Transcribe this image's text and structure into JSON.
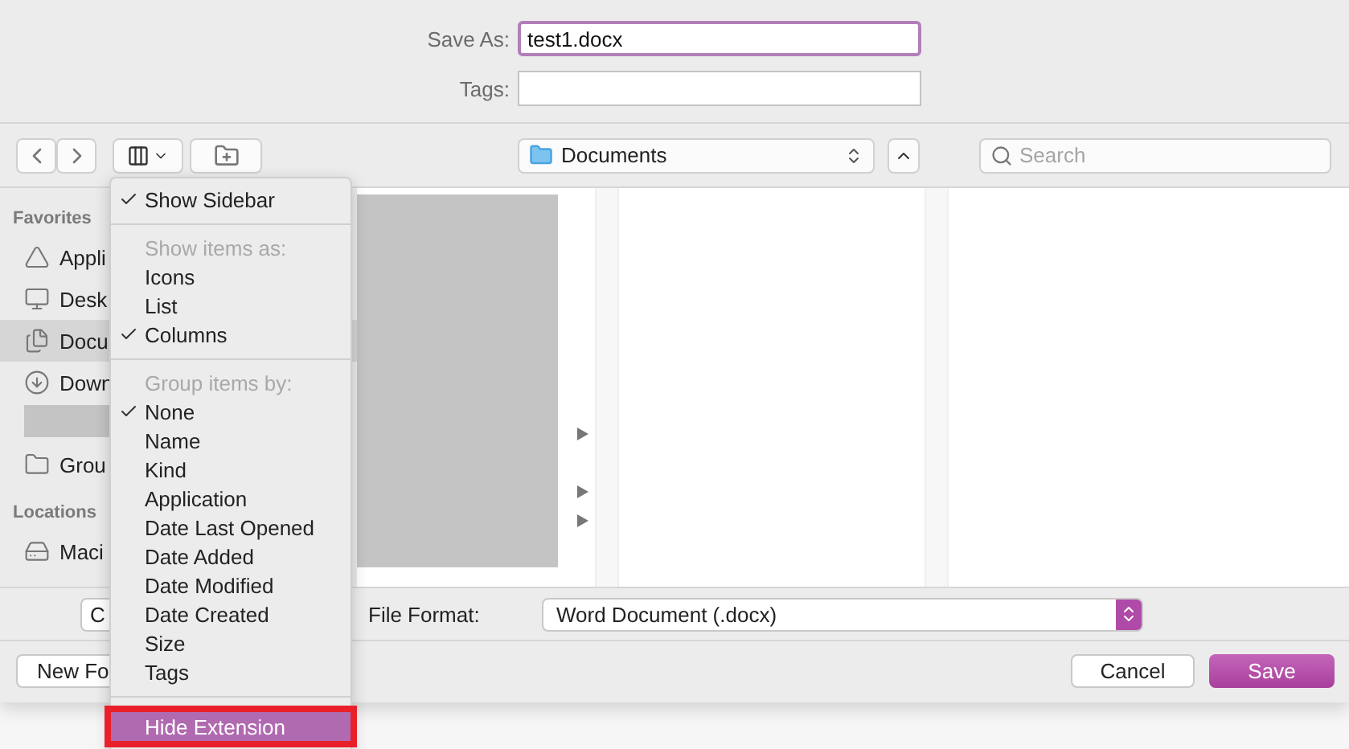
{
  "save_as": {
    "label": "Save As:",
    "value": "test1.docx"
  },
  "tags": {
    "label": "Tags:"
  },
  "location": {
    "label": "Documents"
  },
  "search": {
    "placeholder": "Search"
  },
  "sidebar": {
    "sections": [
      {
        "title": "Favorites",
        "items": [
          {
            "kind": "apps",
            "label": "Appli",
            "selected": false
          },
          {
            "kind": "desktop",
            "label": "Desk",
            "selected": false
          },
          {
            "kind": "documents",
            "label": "Docu",
            "selected": true
          },
          {
            "kind": "downloads",
            "label": "Down",
            "selected": false
          },
          {
            "kind": "redacted",
            "selected": false
          },
          {
            "kind": "folder",
            "label": "Grou",
            "selected": false
          }
        ]
      },
      {
        "title": "Locations",
        "items": [
          {
            "kind": "disk",
            "label": "Maci",
            "selected": false
          }
        ]
      }
    ]
  },
  "options": {
    "button": "C",
    "file_format_label": "File Format:",
    "file_format": "Word Document (.docx)"
  },
  "buttons": {
    "new_folder": "New Fo",
    "cancel": "Cancel",
    "save": "Save"
  },
  "menu": [
    {
      "kind": "item",
      "label": "Show Sidebar",
      "checked": true,
      "selected": false
    },
    {
      "kind": "separator"
    },
    {
      "kind": "header",
      "label": "Show items as:"
    },
    {
      "kind": "item",
      "label": "Icons",
      "checked": false,
      "selected": false
    },
    {
      "kind": "item",
      "label": "List",
      "checked": false,
      "selected": false
    },
    {
      "kind": "item",
      "label": "Columns",
      "checked": true,
      "selected": false
    },
    {
      "kind": "separator"
    },
    {
      "kind": "header",
      "label": "Group items by:"
    },
    {
      "kind": "item",
      "label": "None",
      "checked": true,
      "selected": false
    },
    {
      "kind": "item",
      "label": "Name",
      "checked": false,
      "selected": false
    },
    {
      "kind": "item",
      "label": "Kind",
      "checked": false,
      "selected": false
    },
    {
      "kind": "item",
      "label": "Application",
      "checked": false,
      "selected": false
    },
    {
      "kind": "item",
      "label": "Date Last Opened",
      "checked": false,
      "selected": false
    },
    {
      "kind": "item",
      "label": "Date Added",
      "checked": false,
      "selected": false
    },
    {
      "kind": "item",
      "label": "Date Modified",
      "checked": false,
      "selected": false
    },
    {
      "kind": "item",
      "label": "Date Created",
      "checked": false,
      "selected": false
    },
    {
      "kind": "item",
      "label": "Size",
      "checked": false,
      "selected": false
    },
    {
      "kind": "item",
      "label": "Tags",
      "checked": false,
      "selected": false
    },
    {
      "kind": "separator"
    },
    {
      "kind": "item",
      "label": "Hide Extension",
      "checked": false,
      "selected": true,
      "annotated": true
    }
  ]
}
